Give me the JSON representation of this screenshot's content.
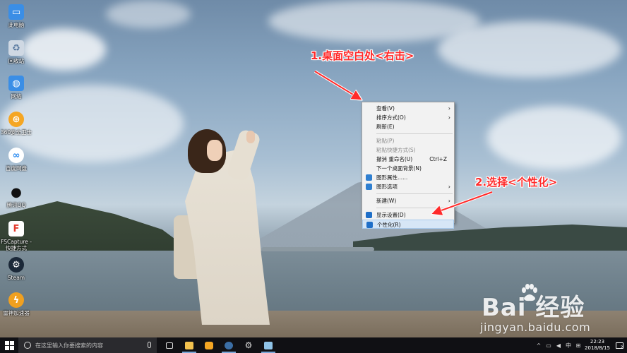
{
  "desktop": {
    "icons": [
      {
        "label": "此电脑",
        "icon": "this-pc-icon",
        "color": "#3a8ee6"
      },
      {
        "label": "回收站",
        "icon": "recycle-bin-icon",
        "color": "#cfd8e3"
      },
      {
        "label": "网络",
        "icon": "network-icon",
        "color": "#3a8ee6"
      },
      {
        "label": "360安全卫士",
        "icon": "app-icon",
        "color": "#f5a623"
      },
      {
        "label": "百度网盘",
        "icon": "baidu-netdisk-icon",
        "color": "#2d8cf0"
      },
      {
        "label": "腾讯QQ",
        "icon": "qq-icon",
        "color": "#111111"
      },
      {
        "label": "FSCapture -\n快捷方式",
        "icon": "fscapture-icon",
        "color": "#e33b2e"
      },
      {
        "label": "Steam",
        "icon": "steam-icon",
        "color": "#1b2838"
      },
      {
        "label": "雷神加速器",
        "icon": "leishen-icon",
        "color": "#f0a020"
      }
    ]
  },
  "context_menu": {
    "items": [
      {
        "label": "查看(V)",
        "submenu": true,
        "disabled": false
      },
      {
        "label": "排序方式(O)",
        "submenu": true,
        "disabled": false
      },
      {
        "label": "刷新(E)",
        "submenu": false,
        "disabled": false
      },
      {
        "sep": true
      },
      {
        "label": "粘贴(P)",
        "disabled": true
      },
      {
        "label": "粘贴快捷方式(S)",
        "disabled": true
      },
      {
        "label": "撤消 重命名(U)",
        "shortcut": "Ctrl+Z",
        "disabled": false
      },
      {
        "label": "下一个桌面背景(N)",
        "disabled": false
      },
      {
        "label": "图形属性......",
        "icon": "intel-graphics-icon",
        "disabled": false
      },
      {
        "label": "图形选项",
        "icon": "intel-graphics-icon",
        "submenu": true,
        "disabled": false
      },
      {
        "sep": true
      },
      {
        "label": "新建(W)",
        "submenu": true,
        "disabled": false
      },
      {
        "sep": true
      },
      {
        "label": "显示设置(D)",
        "icon": "display-settings-icon",
        "disabled": false
      },
      {
        "label": "个性化(R)",
        "icon": "personalize-icon",
        "disabled": false,
        "highlighted": true
      }
    ]
  },
  "annotations": {
    "step1": "1.桌面空白处<右击>",
    "step2": "2.选择<个性化>",
    "color": "#ff2a2a"
  },
  "watermark": {
    "logo": "Bai 经验",
    "url": "jingyan.baidu.com"
  },
  "taskbar": {
    "search_placeholder": "在这里输入你要搜索的内容",
    "apps": [
      {
        "icon": "task-view-icon",
        "color": "#dddddd"
      },
      {
        "icon": "file-explorer-icon",
        "color": "#f2c14e"
      },
      {
        "icon": "360-browser-icon",
        "color": "#f5a623"
      },
      {
        "icon": "steam-icon",
        "color": "#3b6ea5"
      },
      {
        "icon": "settings-icon",
        "color": "#dddddd"
      },
      {
        "icon": "notepad-icon",
        "color": "#8fc3e8"
      }
    ],
    "time": "22:23",
    "date": "2018/8/15",
    "ime": "中",
    "notification_count": "2"
  }
}
